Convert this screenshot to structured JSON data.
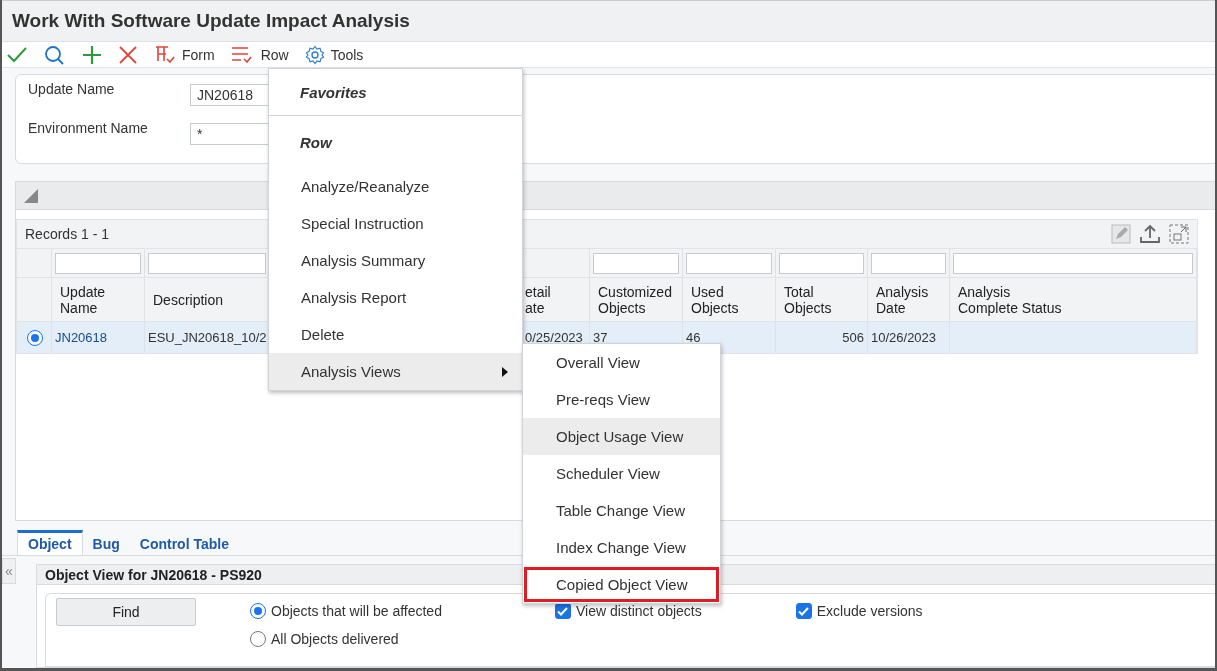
{
  "window": {
    "title": "Work With Software Update Impact Analysis"
  },
  "toolbar": {
    "menus": [
      {
        "label": "Form",
        "kind": "form"
      },
      {
        "label": "Row",
        "kind": "row"
      },
      {
        "label": "Tools",
        "kind": "tools"
      }
    ]
  },
  "form_fields": [
    {
      "label": "Update Name",
      "value": "JN20618"
    },
    {
      "label": "Environment Name",
      "value": "*"
    }
  ],
  "grid": {
    "records": "Records 1 - 1",
    "columns": [
      {
        "label": "Update\nName"
      },
      {
        "label": "Description"
      },
      {
        "label": "etail\nate"
      },
      {
        "label": "Customized\nObjects"
      },
      {
        "label": "Used\nObjects"
      },
      {
        "label": "Total\nObjects"
      },
      {
        "label": "Analysis\nDate"
      },
      {
        "label": "Analysis\nComplete Status"
      }
    ],
    "rows": [
      {
        "selected": true,
        "cells": [
          "JN20618",
          "ESU_JN20618_10/2",
          "0/25/2023",
          "37",
          "46",
          "506",
          "10/26/2023"
        ]
      }
    ]
  },
  "row_menu": {
    "items": [
      {
        "kind": "header",
        "label": "Favorites"
      },
      {
        "kind": "header",
        "label": "Row"
      },
      {
        "kind": "item",
        "label": "Analyze/Reanalyze",
        "selected": false
      },
      {
        "kind": "item",
        "label": "Special Instruction",
        "selected": false
      },
      {
        "kind": "item",
        "label": "Analysis Summary",
        "selected": false
      },
      {
        "kind": "item",
        "label": "Analysis Report",
        "selected": false
      },
      {
        "kind": "item",
        "label": "Delete",
        "selected": false
      },
      {
        "kind": "submenu",
        "label": "Analysis Views",
        "selected": true
      }
    ]
  },
  "submenu": {
    "items": [
      {
        "label": "Overall View",
        "selected": false,
        "outlined": false
      },
      {
        "label": "Pre-reqs View",
        "selected": false,
        "outlined": false
      },
      {
        "label": "Object Usage View",
        "selected": true,
        "outlined": false
      },
      {
        "label": "Scheduler View",
        "selected": false,
        "outlined": false
      },
      {
        "label": "Table Change View",
        "selected": false,
        "outlined": false
      },
      {
        "label": "Index Change View",
        "selected": false,
        "outlined": false
      },
      {
        "label": "Copied Object View",
        "selected": false,
        "outlined": true
      }
    ]
  },
  "collapse_handle": "«",
  "tabs": [
    {
      "label": "Object",
      "selected": true
    },
    {
      "label": "Bug",
      "selected": false
    },
    {
      "label": "Control Table",
      "selected": false
    }
  ],
  "object_view": {
    "title": "Object View for JN20618 - PS920",
    "find_button": "Find",
    "radios": [
      {
        "label": "Objects that will be affected",
        "selected": true
      },
      {
        "label": "All Objects delivered",
        "selected": false
      }
    ],
    "checkboxes": [
      {
        "label": "View distinct objects",
        "checked": true
      },
      {
        "label": "Exclude versions",
        "checked": true
      }
    ]
  }
}
